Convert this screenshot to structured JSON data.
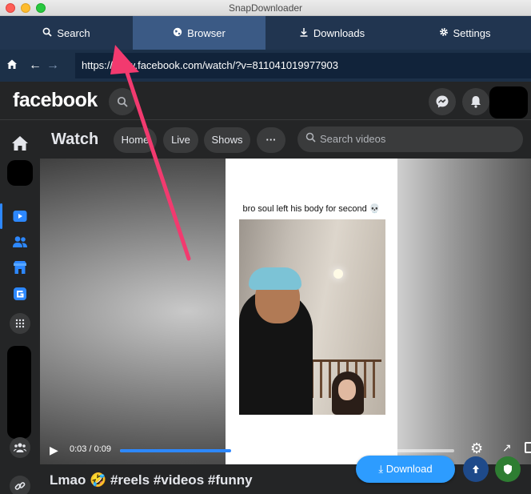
{
  "window": {
    "title": "SnapDownloader"
  },
  "tabs": [
    {
      "label": "Search",
      "icon": "search-icon"
    },
    {
      "label": "Browser",
      "icon": "globe-icon"
    },
    {
      "label": "Downloads",
      "icon": "download-icon"
    },
    {
      "label": "Settings",
      "icon": "gear-icon"
    }
  ],
  "active_tab": "Browser",
  "nav": {
    "url": "https://www.facebook.com/watch/?v=811041019977903"
  },
  "facebook": {
    "logo": "facebook",
    "watch_title": "Watch",
    "pills": [
      "Home",
      "Live",
      "Shows",
      "···"
    ],
    "search_placeholder": "Search videos"
  },
  "video": {
    "caption": "bro soul left his body for second 💀",
    "time": "0:03 / 0:09",
    "progress_fraction": 0.333,
    "title": "Lmao 🤣 #reels #videos #funny"
  },
  "download_button": {
    "label": "Download"
  },
  "colors": {
    "tabbar": "#213550",
    "active_tab": "#3b5a85",
    "facebook_bg": "#242526",
    "accent": "#2d88ff",
    "download_button": "#2d9cff",
    "annotation_arrow": "#f23a6f"
  }
}
